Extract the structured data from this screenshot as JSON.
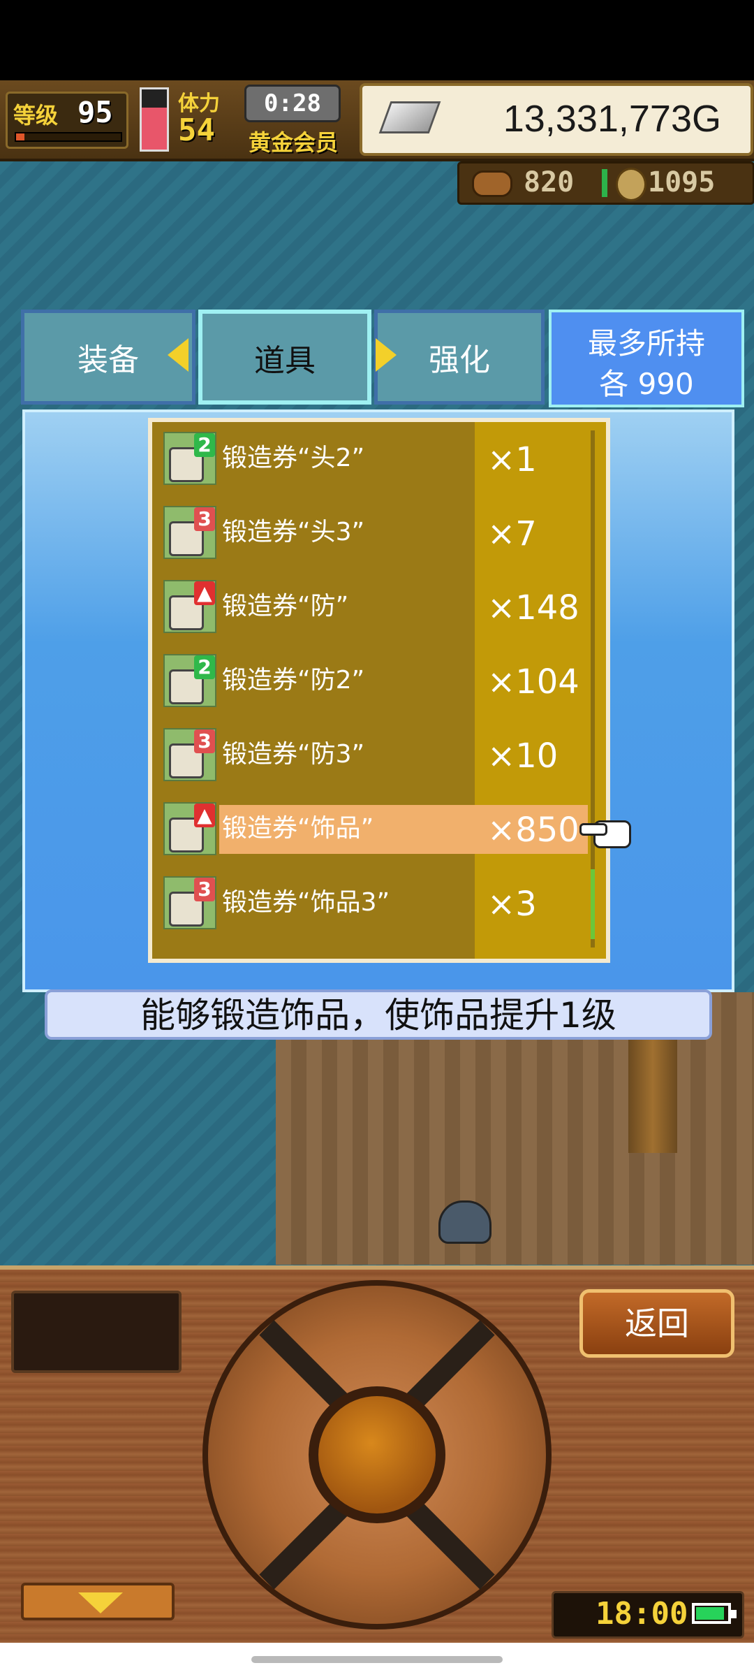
{
  "hud": {
    "level_label": "等级",
    "level": "95",
    "stamina_label": "体力",
    "stamina": "54",
    "timer": "0:28",
    "member": "黄金会员",
    "gold": "13,331,773G"
  },
  "resources": {
    "wood": "820",
    "coin": "1095"
  },
  "tabs": {
    "equip": "装备",
    "items": "道具",
    "enhance": "强化"
  },
  "max_hold": {
    "line1": "最多所持",
    "line2": "各 990"
  },
  "items": [
    {
      "name": "锻造券“头2”",
      "qty": "×1",
      "badge": "2"
    },
    {
      "name": "锻造券“头3”",
      "qty": "×7",
      "badge": "3"
    },
    {
      "name": "锻造券“防”",
      "qty": "×148",
      "badge": ""
    },
    {
      "name": "锻造券“防2”",
      "qty": "×104",
      "badge": "2"
    },
    {
      "name": "锻造券“防3”",
      "qty": "×10",
      "badge": "3"
    },
    {
      "name": "锻造券“饰品”",
      "qty": "×850",
      "badge": "",
      "selected": true
    },
    {
      "name": "锻造券“饰品3”",
      "qty": "×3",
      "badge": "3"
    }
  ],
  "description": "能够锻造饰品，使饰品提升1级",
  "controls": {
    "back": "返回"
  },
  "clock": "18:00"
}
